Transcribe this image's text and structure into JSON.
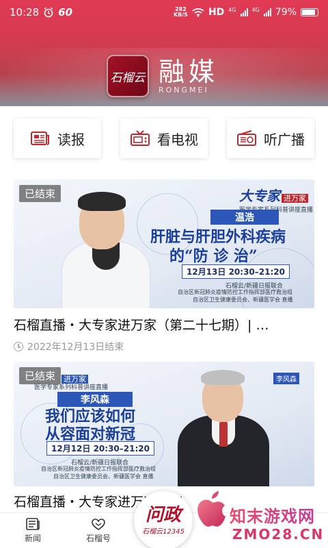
{
  "status_bar": {
    "time": "10:28",
    "speed_kb": "60",
    "net_rate_top": "282",
    "net_rate_bottom": "KB/S",
    "hd_label": "HD",
    "g1": "4G",
    "g2": "4G",
    "battery": "79%"
  },
  "brand": {
    "logo_text": "石榴云",
    "name": "融媒",
    "subtitle": "RONGMEI"
  },
  "quick_actions": [
    {
      "label": "读报",
      "icon": "newspaper-icon"
    },
    {
      "label": "看电视",
      "icon": "tv-icon"
    },
    {
      "label": "听广播",
      "icon": "radio-icon"
    }
  ],
  "cards": [
    {
      "badge": "已结束",
      "title": "石榴直播・大专家进万家（第二十七期）| …",
      "meta": "2022年12月13日结束",
      "poster": {
        "series": "大专家",
        "series_tag": "进万家",
        "series_sub": "医学专家系列科普讲座直播",
        "expert": "温浩",
        "topic_line1": "肝脏与肝胆外科疾病",
        "topic_line2": "的“防 诊 治”",
        "date": "12月13日 20:30–21:20",
        "organizer1": "石榴云/新疆日报联合",
        "organizer2": "自治区新冠肺炎疫情防控工作指挥部医疗救治组",
        "organizer3": "自治区卫生健康委员会、新疆医学会 直播"
      }
    },
    {
      "badge": "已结束",
      "title": "石榴直播・大专家进万家（第",
      "meta": "",
      "poster": {
        "series_tag": "进万家",
        "series_sub": "医学专家系列科普讲座直播",
        "expert": "李风森",
        "expert_tag": "李风森",
        "topic_line1": "我们应该如何",
        "topic_line2": "从容面对新冠",
        "date": "12月12日 20:30–21:20",
        "organizer1": "石榴云/新疆日报联合",
        "organizer2": "自治区新冠肺炎疫情防控工作指挥部医疗救治组",
        "organizer3": "自治区卫生健康委员会、新疆医学会 直播"
      }
    }
  ],
  "bottom_nav": [
    {
      "label": "新闻",
      "icon": "news-icon"
    },
    {
      "label": "石榴号",
      "icon": "pomegranate-icon"
    }
  ],
  "float_button": {
    "main": "问政",
    "sub": "石榴云12345"
  },
  "watermark": {
    "text": "知末游戏网",
    "url": "ZMO28.CN"
  },
  "colors": {
    "brand_red": "#d63a50",
    "accent_red": "#c1272d",
    "poster_blue": "#1f47a8"
  }
}
